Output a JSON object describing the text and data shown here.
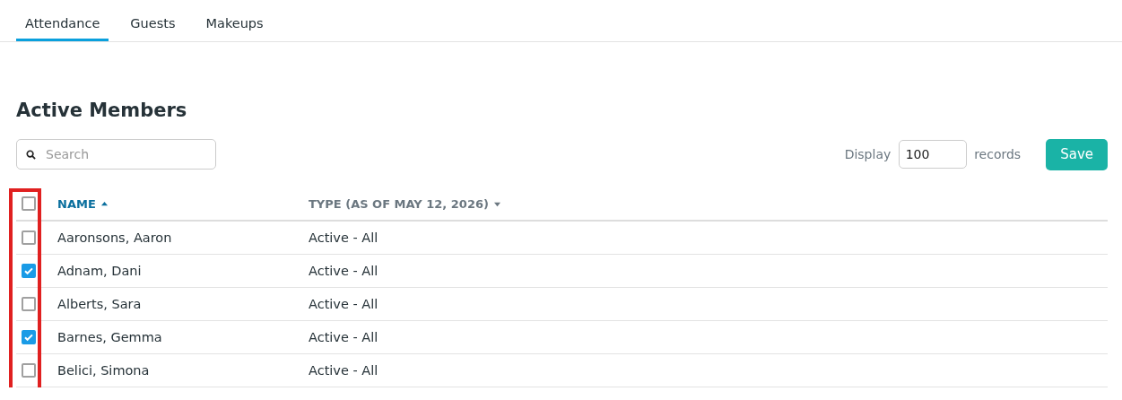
{
  "tabs": [
    {
      "label": "Attendance",
      "selected": true
    },
    {
      "label": "Guests",
      "selected": false
    },
    {
      "label": "Makeups",
      "selected": false
    }
  ],
  "heading": "Active Members",
  "search": {
    "placeholder": "Search"
  },
  "display": {
    "label": "Display",
    "value": "100",
    "suffix": "records"
  },
  "save_button": "Save",
  "table": {
    "select_all": {
      "checked": false
    },
    "columns": [
      {
        "label": "NAME",
        "kind": "sort-ascending",
        "active": true
      },
      {
        "label": "TYPE (AS OF MAY 12, 2026)",
        "kind": "sort-descending",
        "active": false
      }
    ],
    "rows": [
      {
        "name": "Aaronsons, Aaron",
        "type": "Active - All",
        "checked": false
      },
      {
        "name": "Adnam, Dani",
        "type": "Active - All",
        "checked": true
      },
      {
        "name": "Alberts, Sara",
        "type": "Active - All",
        "checked": false
      },
      {
        "name": "Barnes, Gemma",
        "type": "Active - All",
        "checked": true
      },
      {
        "name": "Belici, Simona",
        "type": "Active - All",
        "checked": false
      }
    ]
  },
  "annotations": [
    {
      "kind": "box"
    }
  ]
}
